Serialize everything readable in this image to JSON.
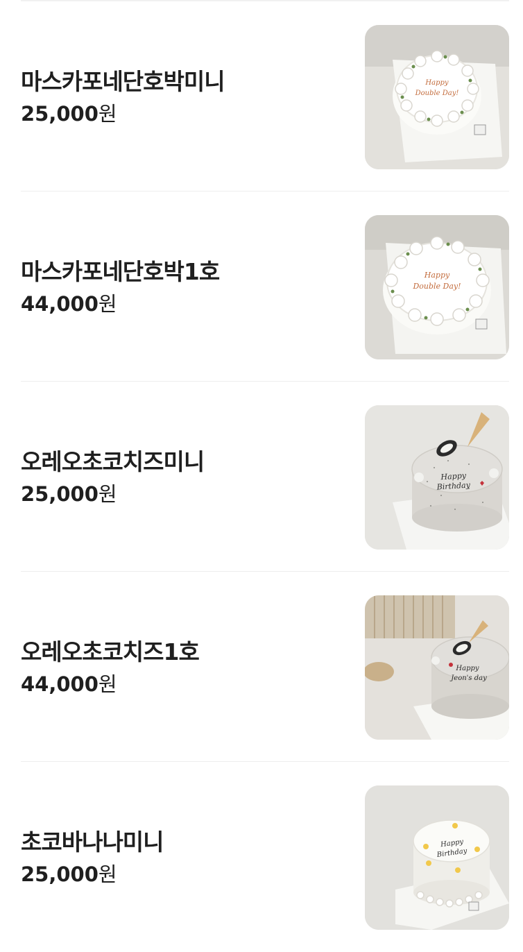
{
  "items": [
    {
      "name": "마스카포네단호박미니",
      "price": "25,000",
      "unit": "원",
      "image": "cake-photo",
      "cake_message": "Happy Double Day!"
    },
    {
      "name": "마스카포네단호박1호",
      "price": "44,000",
      "unit": "원",
      "image": "cake-photo",
      "cake_message": "Happy Double Day!"
    },
    {
      "name": "오레오초코치즈미니",
      "price": "25,000",
      "unit": "원",
      "image": "cake-photo",
      "cake_message": "Happy Birthday"
    },
    {
      "name": "오레오초코치즈1호",
      "price": "44,000",
      "unit": "원",
      "image": "cake-photo",
      "cake_message": "Happy Jeon's day"
    },
    {
      "name": "초코바나나미니",
      "price": "25,000",
      "unit": "원",
      "image": "cake-photo",
      "cake_message": "Happy Birthday"
    }
  ]
}
